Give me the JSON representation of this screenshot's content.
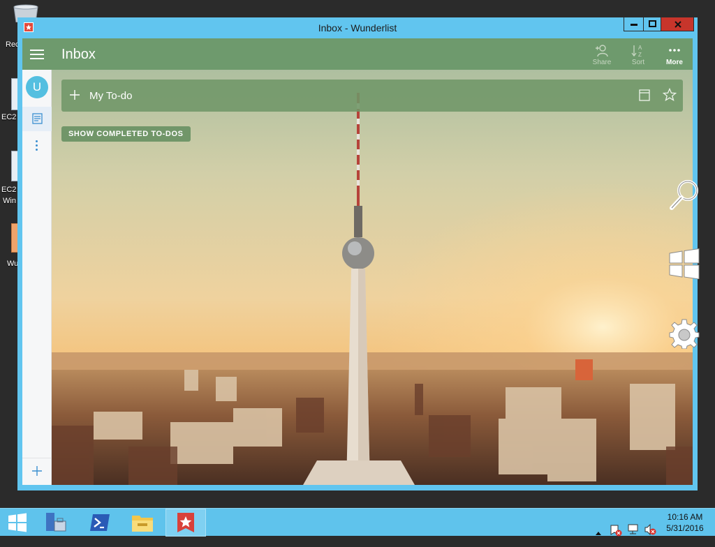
{
  "window": {
    "title": "Inbox - Wunderlist",
    "controls": {
      "minimize": "minimize-icon",
      "maximize": "maximize-icon",
      "close": "close-icon"
    }
  },
  "desktop_icons": [
    {
      "label": "Rec",
      "icon": "recycle-bin-icon"
    },
    {
      "label": "EC2",
      "icon": "shortcut-icon"
    },
    {
      "label": "EC2",
      "label2": "Win",
      "icon": "shortcut-icon"
    },
    {
      "label": "Wu",
      "icon": "shortcut-icon"
    }
  ],
  "header": {
    "title": "Inbox",
    "menu_icon": "hamburger-icon",
    "actions": [
      {
        "label": "Share",
        "icon": "add-person-icon",
        "enabled": false
      },
      {
        "label": "Sort",
        "icon": "sort-az-icon",
        "enabled": false
      },
      {
        "label": "More",
        "icon": "more-dots-icon",
        "enabled": true
      }
    ]
  },
  "sidebar": {
    "avatar_initial": "U",
    "items": [
      {
        "icon": "inbox-icon",
        "selected": true
      },
      {
        "icon": "more-vertical-icon"
      }
    ],
    "add_icon": "plus-icon"
  },
  "add_todo": {
    "placeholder": "My To-do",
    "icons": [
      "plus-icon",
      "calendar-icon",
      "star-icon"
    ]
  },
  "show_completed_label": "SHOW COMPLETED TO-DOS",
  "charms": [
    "search-charm-icon",
    "start-charm-icon",
    "settings-charm-icon"
  ],
  "taskbar": {
    "items": [
      {
        "icon": "start-icon"
      },
      {
        "icon": "server-manager-icon"
      },
      {
        "icon": "powershell-icon"
      },
      {
        "icon": "file-explorer-icon"
      },
      {
        "icon": "wunderlist-icon",
        "active": true
      }
    ],
    "tray": [
      "show-hidden-icon",
      "action-center-icon",
      "network-icon",
      "volume-muted-icon"
    ],
    "time": "10:16 AM",
    "date": "5/31/2016"
  },
  "colors": {
    "window_frame": "#61c5ef",
    "header": "#6e9a6d",
    "close_button": "#c7352b",
    "taskbar": "#5fc3ec",
    "avatar": "#54bfe0"
  }
}
